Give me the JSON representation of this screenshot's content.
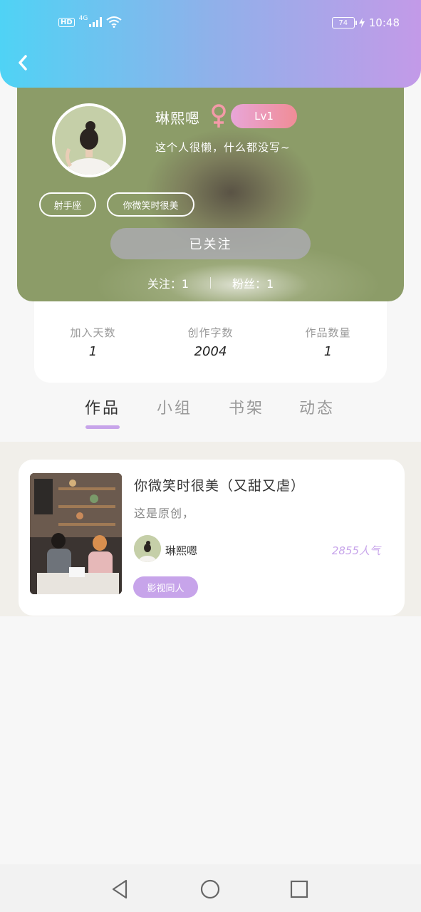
{
  "status_bar": {
    "hd": "HD",
    "network": "4G",
    "battery": "74",
    "time": "10:48"
  },
  "profile": {
    "username": "琳熙嗯",
    "gender_symbol": "♀",
    "level": "Lv1",
    "bio": "这个人很懒，什么都没写~",
    "tags": [
      "射手座",
      "你微笑时很美"
    ],
    "follow_button": "已关注",
    "following_label": "关注：1",
    "followers_label": "粉丝：1"
  },
  "stats": [
    {
      "label": "加入天数",
      "value": "1"
    },
    {
      "label": "创作字数",
      "value": "2004"
    },
    {
      "label": "作品数量",
      "value": "1"
    }
  ],
  "tabs": [
    "作品",
    "小组",
    "书架",
    "动态"
  ],
  "active_tab": "作品",
  "works": [
    {
      "title": "你微笑时很美（又甜又虐）",
      "description": "这是原创，",
      "author": "琳熙嗯",
      "popularity": "2855人气",
      "genre": "影视同人"
    }
  ],
  "colors": {
    "accent": "#c7a4ea",
    "header_gradient_start": "#4fd3f5",
    "header_gradient_end": "#c39ae8",
    "level_gradient_start": "#e8a6d8",
    "level_gradient_end": "#f08c96"
  },
  "icons": {
    "back": "chevron-left-icon",
    "nav_back": "triangle-back-icon",
    "nav_home": "circle-home-icon",
    "nav_recents": "square-recents-icon"
  }
}
